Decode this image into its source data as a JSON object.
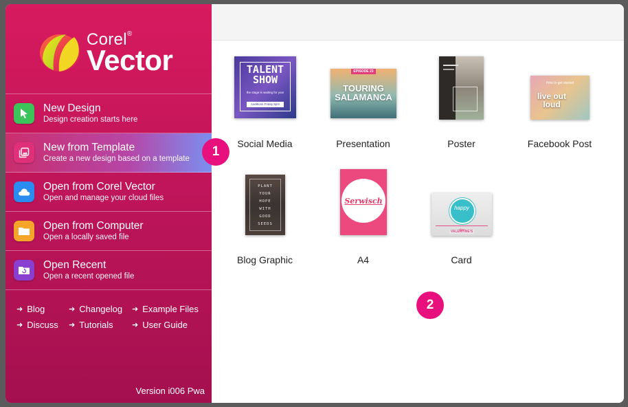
{
  "brand": {
    "corel": "Corel",
    "reg": "®",
    "vector": "Vector"
  },
  "menu": [
    {
      "title": "New Design",
      "subtitle": "Design creation starts here",
      "icon": "pointer-icon",
      "color": "#3cc35a"
    },
    {
      "title": "New from Template",
      "subtitle": "Create a new design based on a template",
      "icon": "image-icon",
      "color": "#e0307a"
    },
    {
      "title": "Open from Corel Vector",
      "subtitle": "Open and manage your cloud files",
      "icon": "cloud-icon",
      "color": "#2a8cf0"
    },
    {
      "title": "Open from Computer",
      "subtitle": "Open a locally saved file",
      "icon": "folder-icon",
      "color": "#f5a52a"
    },
    {
      "title": "Open Recent",
      "subtitle": "Open a recent opened file",
      "icon": "recent-folder-icon",
      "color": "#8a3fd1"
    }
  ],
  "links": {
    "blog": "Blog",
    "changelog": "Changelog",
    "example_files": "Example Files",
    "discuss": "Discuss",
    "tutorials": "Tutorials",
    "user_guide": "User Guide",
    "arrow": "➜"
  },
  "version": "Version i006 Pwa",
  "templates": {
    "social_media": {
      "label": "Social Media",
      "t1": "TALENT",
      "t2": "SHOW",
      "t3": "the stage is waiting for you!",
      "t4": "Auditions Friday 5pm"
    },
    "presentation": {
      "label": "Presentation",
      "ep": "EPISODE 23",
      "t1": "TOURING",
      "t2": "SALAMANCA"
    },
    "poster": {
      "label": "Poster"
    },
    "facebook_post": {
      "label": "Facebook Post",
      "t0": "How to get started",
      "t1": "live out",
      "t2": "loud"
    },
    "blog_graphic": {
      "label": "Blog Graphic",
      "lines": [
        "PLANT",
        "YOUR",
        "HOPE",
        "WITH",
        "GOOD",
        "SEEDS"
      ]
    },
    "a4": {
      "label": "A4",
      "t1": "Serwisch"
    },
    "card": {
      "label": "Card",
      "t1": "happy",
      "t2": "VALENTINE'S",
      "t3": "day"
    }
  },
  "badges": {
    "b1": "1",
    "b2": "2"
  },
  "colors": {
    "accent": "#e8107c",
    "sidebar_top": "#d81a5e",
    "sidebar_bottom": "#a4104f"
  }
}
